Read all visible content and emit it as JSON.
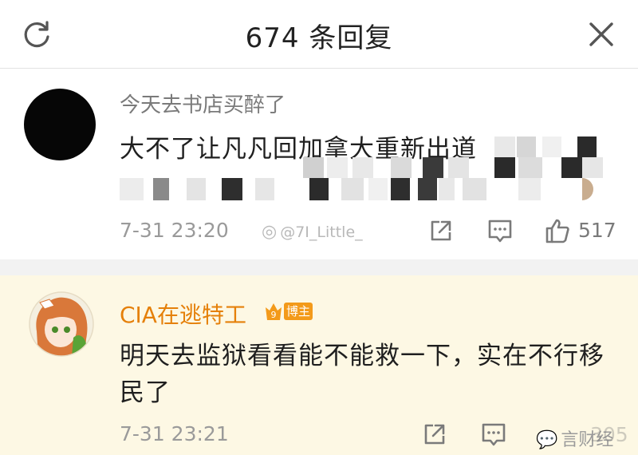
{
  "header": {
    "title": "674 条回复",
    "refresh_icon": "refresh-icon",
    "close_icon": "close-icon"
  },
  "comments": [
    {
      "username": "今天去书店买醉了",
      "text": "大不了让凡凡回加拿大重新出道",
      "time": "7-31 23:20",
      "watermark": "@7I_Little_",
      "like_count": "517"
    },
    {
      "username": "CIA在逃特工",
      "badge": "博主",
      "text": "明天去监狱看看能不能救一下，实在不行移民了",
      "time": "7-31 23:21",
      "like_count": "305",
      "watermark": "言财经"
    }
  ],
  "colors": {
    "accent_name": "#e5800a",
    "highlight_bg": "#fdf8e4",
    "badge": "#f39a1a"
  }
}
